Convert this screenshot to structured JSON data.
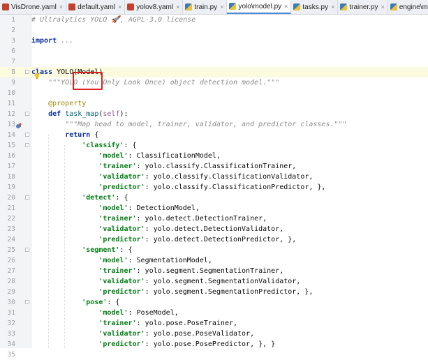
{
  "tabs": [
    {
      "label": "VisDrone.yaml",
      "type": "yaml",
      "active": false
    },
    {
      "label": "default.yaml",
      "type": "yaml",
      "active": false
    },
    {
      "label": "yolov8.yaml",
      "type": "yaml",
      "active": false
    },
    {
      "label": "train.py",
      "type": "py",
      "active": false
    },
    {
      "label": "yolo\\model.py",
      "type": "py",
      "active": true
    },
    {
      "label": "tasks.py",
      "type": "py",
      "active": false
    },
    {
      "label": "trainer.py",
      "type": "py",
      "active": false
    },
    {
      "label": "engine\\model.py",
      "type": "py",
      "active": false
    }
  ],
  "close_glyph": "×",
  "current_line": 8,
  "colors": {
    "highlight_box": "#e02020",
    "current_line_bg": "#fcfadf",
    "keyword": "#0b2fa0",
    "string": "#067d17"
  },
  "lines": [
    {
      "n": "1",
      "t": [
        [
          "cmt",
          "# Ultralytics YOLO 🚀, AGPL-3.0 license"
        ]
      ]
    },
    {
      "n": "2",
      "t": []
    },
    {
      "n": "3",
      "t": [
        [
          "kw",
          "import"
        ],
        [
          "",
          " "
        ],
        [
          "cmt",
          "..."
        ]
      ]
    },
    {
      "n": "6",
      "t": []
    },
    {
      "n": "7",
      "t": []
    },
    {
      "n": "8",
      "t": [
        [
          "kw",
          "class"
        ],
        [
          "",
          " YOLO(Model)"
        ]
      ]
    },
    {
      "n": "9",
      "t": [
        [
          "",
          "    "
        ],
        [
          "doc",
          "\"\"\"YOLO (You Only Look Once) object detection model.\"\"\""
        ]
      ]
    },
    {
      "n": "10",
      "t": []
    },
    {
      "n": "11",
      "t": [
        [
          "",
          "    "
        ],
        [
          "deco",
          "@property"
        ]
      ]
    },
    {
      "n": "12",
      "t": [
        [
          "",
          "    "
        ],
        [
          "kw",
          "def"
        ],
        [
          "",
          " "
        ],
        [
          "fn",
          "task_map"
        ],
        [
          "",
          "("
        ],
        [
          "self",
          "self"
        ],
        [
          "",
          "):"
        ]
      ]
    },
    {
      "n": "13",
      "t": [
        [
          "",
          "        "
        ],
        [
          "doc",
          "\"\"\"Map head to model, trainer, validator, and predictor classes.\"\"\""
        ]
      ]
    },
    {
      "n": "14",
      "t": [
        [
          "",
          "        "
        ],
        [
          "kw",
          "return"
        ],
        [
          "",
          " {"
        ]
      ]
    },
    {
      "n": "15",
      "t": [
        [
          "",
          "            "
        ],
        [
          "str",
          "'classify'"
        ],
        [
          "",
          ": {"
        ]
      ]
    },
    {
      "n": "16",
      "t": [
        [
          "",
          "                "
        ],
        [
          "str",
          "'model'"
        ],
        [
          "",
          ": ClassificationModel,"
        ]
      ]
    },
    {
      "n": "17",
      "t": [
        [
          "",
          "                "
        ],
        [
          "str",
          "'trainer'"
        ],
        [
          "",
          ": yolo.classify.ClassificationTrainer,"
        ]
      ]
    },
    {
      "n": "18",
      "t": [
        [
          "",
          "                "
        ],
        [
          "str",
          "'validator'"
        ],
        [
          "",
          ": yolo.classify.ClassificationValidator,"
        ]
      ]
    },
    {
      "n": "19",
      "t": [
        [
          "",
          "                "
        ],
        [
          "str",
          "'predictor'"
        ],
        [
          "",
          ": yolo.classify.ClassificationPredictor, },"
        ]
      ]
    },
    {
      "n": "20",
      "t": [
        [
          "",
          "            "
        ],
        [
          "str",
          "'detect'"
        ],
        [
          "",
          ": {"
        ]
      ]
    },
    {
      "n": "21",
      "t": [
        [
          "",
          "                "
        ],
        [
          "str",
          "'model'"
        ],
        [
          "",
          ": DetectionModel,"
        ]
      ]
    },
    {
      "n": "22",
      "t": [
        [
          "",
          "                "
        ],
        [
          "str",
          "'trainer'"
        ],
        [
          "",
          ": yolo.detect.DetectionTrainer,"
        ]
      ]
    },
    {
      "n": "23",
      "t": [
        [
          "",
          "                "
        ],
        [
          "str",
          "'validator'"
        ],
        [
          "",
          ": yolo.detect.DetectionValidator,"
        ]
      ]
    },
    {
      "n": "24",
      "t": [
        [
          "",
          "                "
        ],
        [
          "str",
          "'predictor'"
        ],
        [
          "",
          ": yolo.detect.DetectionPredictor, },"
        ]
      ]
    },
    {
      "n": "25",
      "t": [
        [
          "",
          "            "
        ],
        [
          "str",
          "'segment'"
        ],
        [
          "",
          ": {"
        ]
      ]
    },
    {
      "n": "26",
      "t": [
        [
          "",
          "                "
        ],
        [
          "str",
          "'model'"
        ],
        [
          "",
          ": SegmentationModel,"
        ]
      ]
    },
    {
      "n": "27",
      "t": [
        [
          "",
          "                "
        ],
        [
          "str",
          "'trainer'"
        ],
        [
          "",
          ": yolo.segment.SegmentationTrainer,"
        ]
      ]
    },
    {
      "n": "28",
      "t": [
        [
          "",
          "                "
        ],
        [
          "str",
          "'validator'"
        ],
        [
          "",
          ": yolo.segment.SegmentationValidator,"
        ]
      ]
    },
    {
      "n": "29",
      "t": [
        [
          "",
          "                "
        ],
        [
          "str",
          "'predictor'"
        ],
        [
          "",
          ": yolo.segment.SegmentationPredictor, },"
        ]
      ]
    },
    {
      "n": "30",
      "t": [
        [
          "",
          "            "
        ],
        [
          "str",
          "'pose'"
        ],
        [
          "",
          ": {"
        ]
      ]
    },
    {
      "n": "31",
      "t": [
        [
          "",
          "                "
        ],
        [
          "str",
          "'model'"
        ],
        [
          "",
          ": PoseModel,"
        ]
      ]
    },
    {
      "n": "32",
      "t": [
        [
          "",
          "                "
        ],
        [
          "str",
          "'trainer'"
        ],
        [
          "",
          ": yolo.pose.PoseTrainer,"
        ]
      ]
    },
    {
      "n": "33",
      "t": [
        [
          "",
          "                "
        ],
        [
          "str",
          "'validator'"
        ],
        [
          "",
          ": yolo.pose.PoseValidator,"
        ]
      ]
    },
    {
      "n": "34",
      "t": [
        [
          "",
          "                "
        ],
        [
          "str",
          "'predictor'"
        ],
        [
          "",
          ": yolo.pose.PosePredictor, }, }"
        ]
      ]
    },
    {
      "n": "35",
      "t": []
    }
  ]
}
